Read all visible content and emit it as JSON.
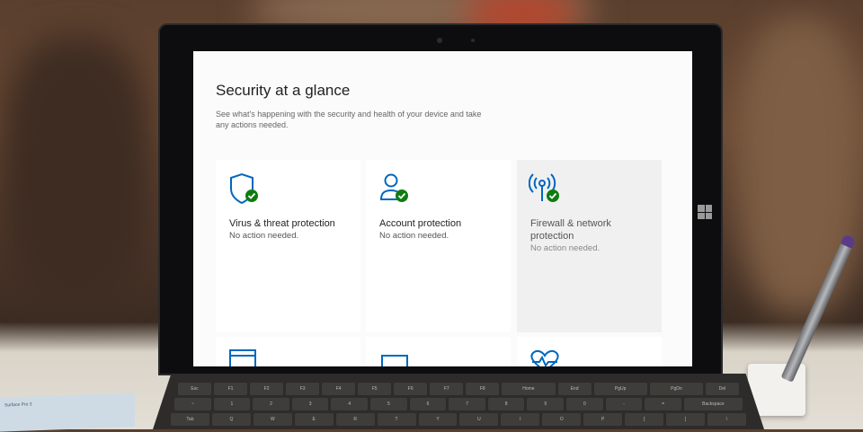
{
  "screen": {
    "title": "Security at a glance",
    "subtitle": "See what's happening with the security and health of your device and take any actions needed.",
    "cards": [
      {
        "name": "Virus & threat protection",
        "status": "No action needed.",
        "icon": "shield-check-icon"
      },
      {
        "name": "Account protection",
        "status": "No action needed.",
        "icon": "person-check-icon"
      },
      {
        "name": "Firewall & network protection",
        "status": "No action needed.",
        "icon": "antenna-check-icon"
      }
    ],
    "accent": "#0067c0",
    "ok_color": "#107c10"
  },
  "keyboard": {
    "rows": [
      [
        "Esc",
        "F1",
        "F2",
        "F3",
        "F4",
        "F5",
        "F6",
        "F7",
        "F8",
        "Home",
        "End",
        "PgUp",
        "PgDn",
        "Del"
      ],
      [
        "~",
        "1",
        "2",
        "3",
        "4",
        "5",
        "6",
        "7",
        "8",
        "9",
        "0",
        "-",
        "=",
        "Backspace"
      ],
      [
        "Tab",
        "Q",
        "W",
        "E",
        "R",
        "T",
        "Y",
        "U",
        "I",
        "O",
        "P",
        "[",
        "]",
        "\\"
      ]
    ]
  },
  "box_label": "Surface Pro 3"
}
